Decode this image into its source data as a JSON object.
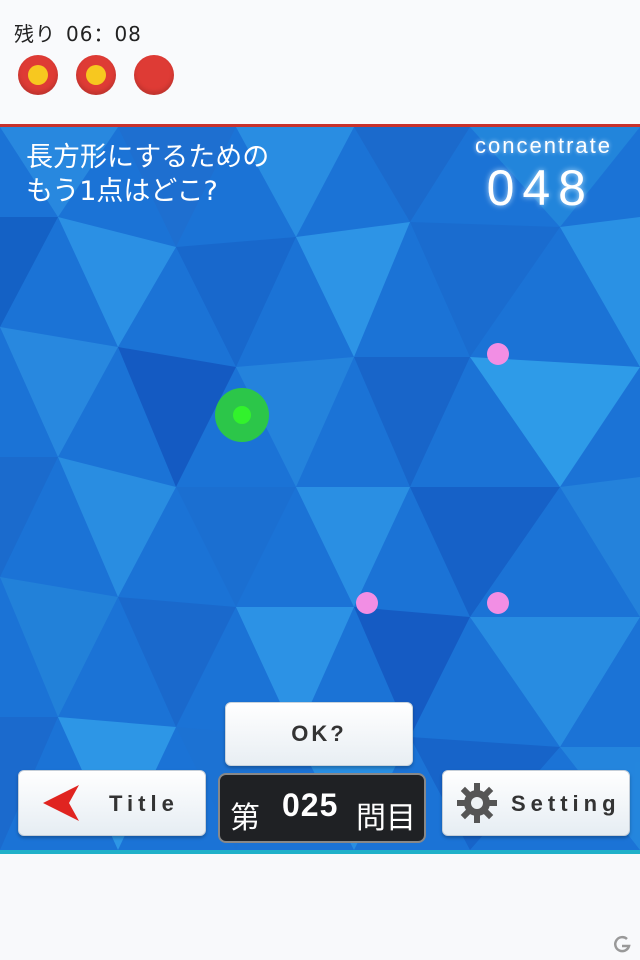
{
  "status": {
    "remaining_label": "残り",
    "remaining_time": "06：08",
    "lives": [
      {
        "state": "full"
      },
      {
        "state": "full"
      },
      {
        "state": "empty"
      }
    ]
  },
  "question": {
    "line1": "長方形にするための",
    "line2": "もう1点はどこ?"
  },
  "concentrate": {
    "label": "concentrate",
    "value": "048"
  },
  "buttons": {
    "ok_label": "OK?",
    "title_label": "Title",
    "setting_label": "Setting"
  },
  "counter": {
    "prefix": "第",
    "number": "025",
    "suffix": "問目"
  },
  "colors": {
    "accent_red": "#de3b35",
    "life_core": "#f7c81f",
    "point_pink": "#f28ee4",
    "cursor_green": "#2cc649",
    "play_blue": "#1b73d6",
    "teal": "#1fb0c9"
  },
  "icons": {
    "title_button": "arrow-left-icon",
    "setting_button": "gear-icon",
    "watermark": "logo-g-icon"
  }
}
